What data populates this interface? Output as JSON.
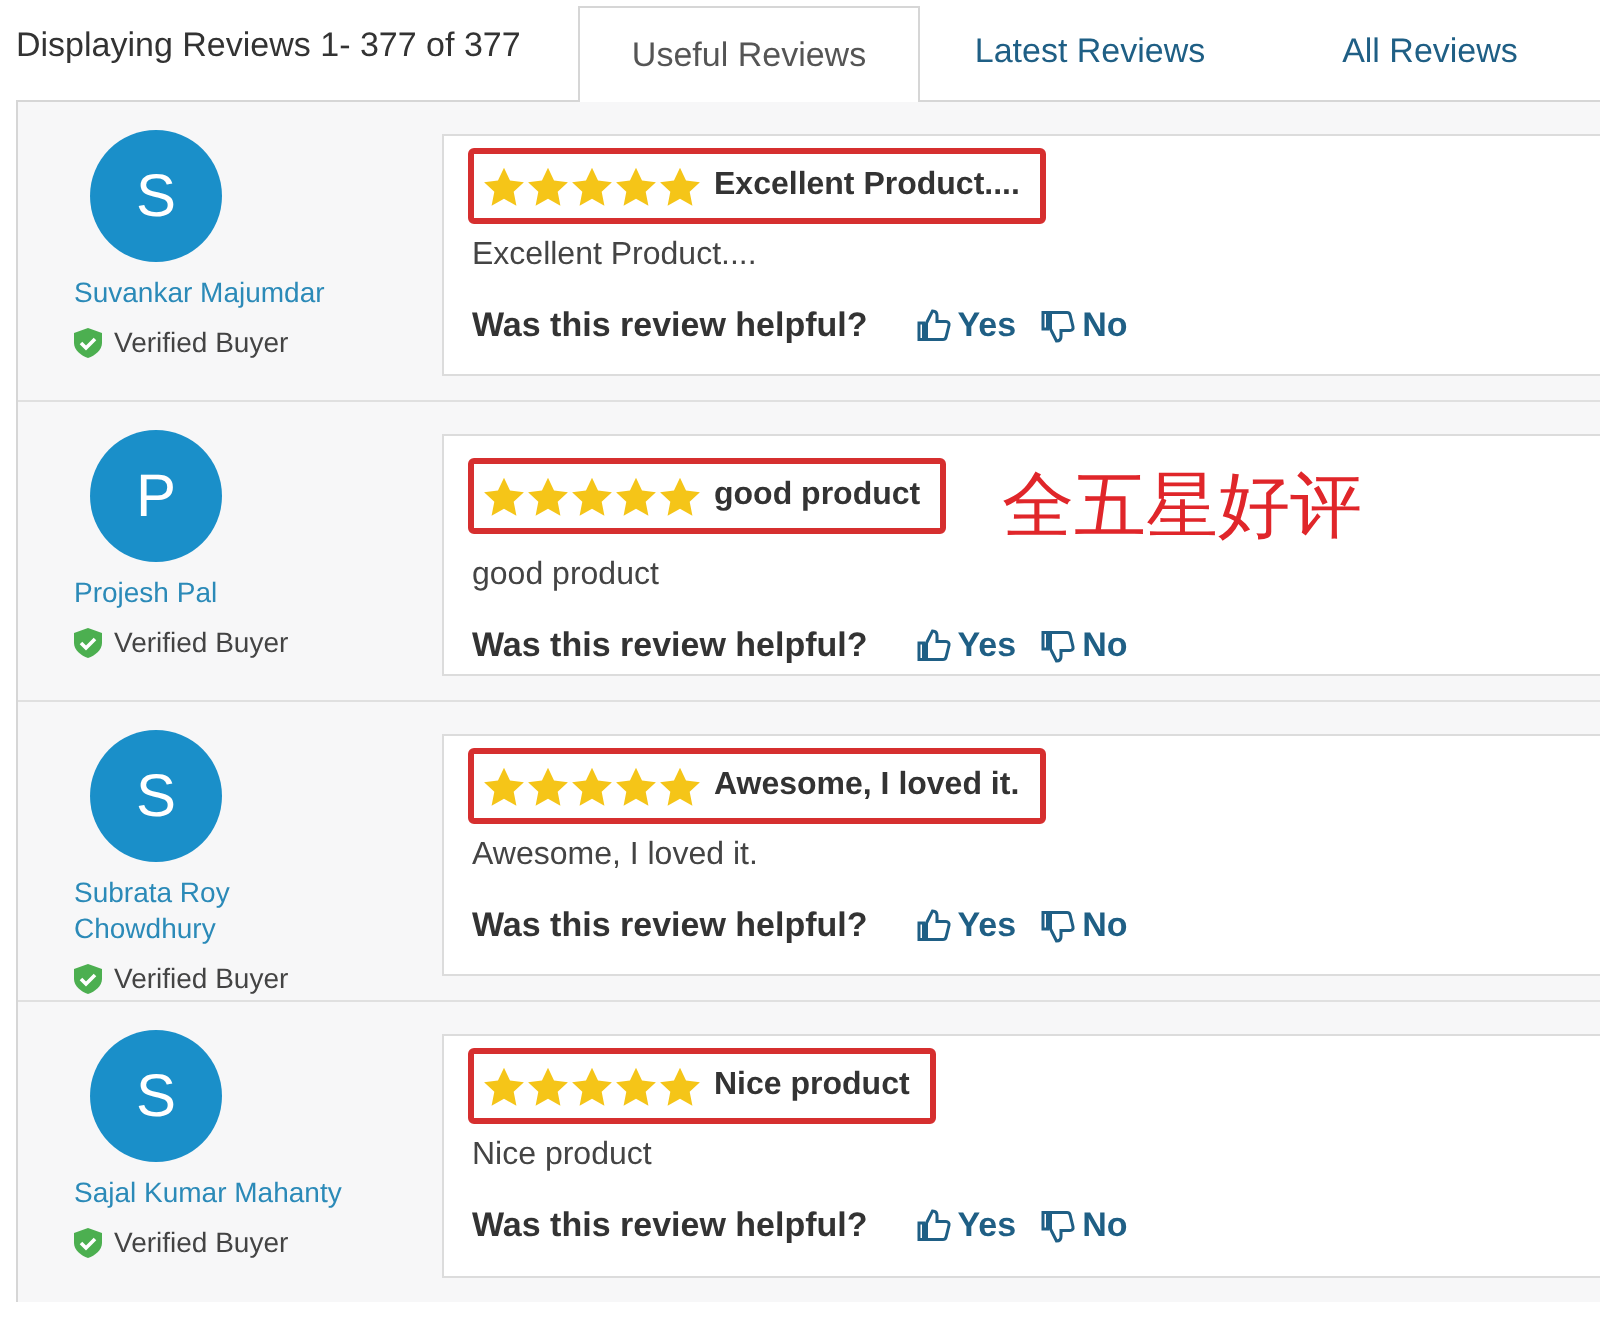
{
  "summary": "Displaying Reviews 1- 377 of 377",
  "tabs": [
    {
      "label": "Useful Reviews",
      "selected": true
    },
    {
      "label": "Latest Reviews",
      "selected": false
    },
    {
      "label": "All Reviews",
      "selected": false
    }
  ],
  "reviews": [
    {
      "initial": "S",
      "name": "Suvankar Majumdar",
      "badge": "Verified Buyer",
      "stars": 5,
      "title": "Excellent Product....",
      "highlighted": true,
      "body": "Excellent Product....",
      "helpful_prompt": "Was this review helpful?",
      "yes": "Yes",
      "no": "No"
    },
    {
      "initial": "P",
      "name": "Projesh Pal",
      "badge": "Verified Buyer",
      "stars": 5,
      "title": "good product",
      "highlighted": true,
      "annotation": "全五星好评",
      "body": "good product",
      "helpful_prompt": "Was this review helpful?",
      "yes": "Yes",
      "no": "No"
    },
    {
      "initial": "S",
      "name": "Subrata Roy Chowdhury",
      "badge": "Verified Buyer",
      "stars": 5,
      "title": "Awesome, I loved it.",
      "highlighted": true,
      "body": "Awesome, I loved it.",
      "helpful_prompt": "Was this review helpful?",
      "yes": "Yes",
      "no": "No"
    },
    {
      "initial": "S",
      "name": "Sajal Kumar Mahanty",
      "badge": "Verified Buyer",
      "stars": 5,
      "title": "Nice product",
      "highlighted": true,
      "body": "Nice product",
      "helpful_prompt": "Was this review helpful?",
      "yes": "Yes",
      "no": "No"
    }
  ]
}
